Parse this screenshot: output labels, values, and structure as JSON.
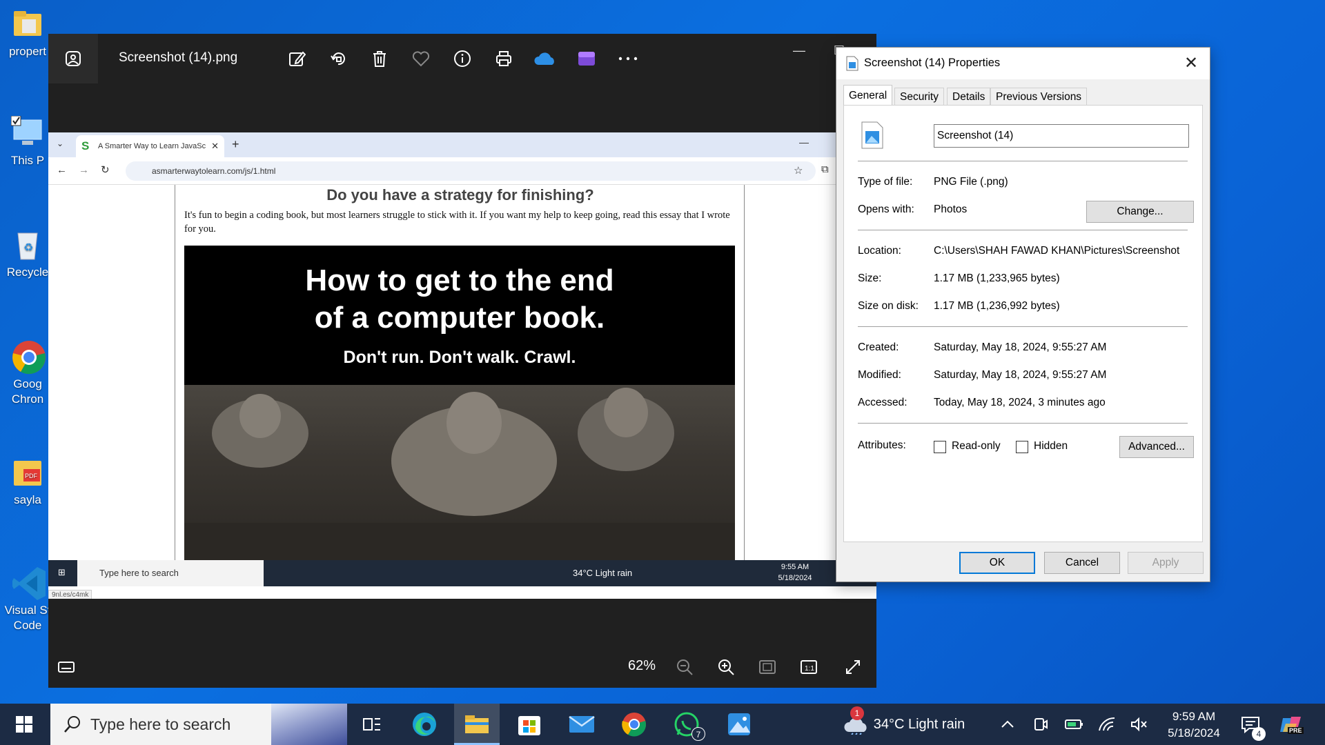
{
  "desktop": {
    "icons": [
      {
        "label": "propert",
        "icon": "folder-icon"
      },
      {
        "label": "This P",
        "icon": "this-pc-icon"
      },
      {
        "label": "Recycle",
        "icon": "recycle-bin-icon"
      },
      {
        "label": "Goog",
        "label2": "Chron",
        "icon": "chrome-icon"
      },
      {
        "label": "sayla",
        "icon": "pdf-folder-icon"
      },
      {
        "label": "Visual St",
        "label2": "Code",
        "icon": "vscode-icon"
      }
    ]
  },
  "photos": {
    "file_title": "Screenshot (14).png",
    "toolbar": [
      "edit-image-icon",
      "rotate-icon",
      "delete-icon",
      "favorite-icon",
      "info-icon",
      "print-icon",
      "onedrive-icon",
      "clipchamp-icon",
      "more-icon"
    ],
    "zoom": "62%",
    "window_controls": {
      "minimize": "—",
      "maximize": "☐"
    }
  },
  "screenshot": {
    "tab_title": "A Smarter Way to Learn JavaSc",
    "url": "asmarterwaytolearn.com/js/1.html",
    "heading": "Do you have a strategy for finishing?",
    "paragraph": "It's fun to begin a coding book, but most learners struggle to stick with it. If you want my help to keep going, read this essay that I wrote for you.",
    "banner_line1": "How to get to the end",
    "banner_line2": "of a computer book.",
    "banner_sub": "Don't run. Don't walk. Crawl.",
    "status_link": "9nl.es/c4mk",
    "taskbar_search": "Type here to search",
    "weather": "34°C  Light rain",
    "time": "9:55 AM",
    "date": "5/18/2024"
  },
  "properties": {
    "title": "Screenshot (14) Properties",
    "tabs": [
      "General",
      "Security",
      "Details",
      "Previous Versions"
    ],
    "name": "Screenshot (14)",
    "type_label": "Type of file:",
    "type_value": "PNG File (.png)",
    "opens_label": "Opens with:",
    "opens_value": "Photos",
    "change_btn": "Change...",
    "location_label": "Location:",
    "location_value": "C:\\Users\\SHAH FAWAD KHAN\\Pictures\\Screenshot",
    "size_label": "Size:",
    "size_value": "1.17 MB (1,233,965 bytes)",
    "disk_label": "Size on disk:",
    "disk_value": "1.17 MB (1,236,992 bytes)",
    "created_label": "Created:",
    "created_value": "Saturday, May 18, 2024, 9:55:27 AM",
    "modified_label": "Modified:",
    "modified_value": "Saturday, May 18, 2024, 9:55:27 AM",
    "accessed_label": "Accessed:",
    "accessed_value": "Today, May 18, 2024, 3 minutes ago",
    "attributes_label": "Attributes:",
    "readonly_label": "Read-only",
    "hidden_label": "Hidden",
    "advanced_btn": "Advanced...",
    "ok_btn": "OK",
    "cancel_btn": "Cancel",
    "apply_btn": "Apply",
    "readonly_checked": false,
    "hidden_checked": false
  },
  "taskbar": {
    "search_placeholder": "Type here to search",
    "apps": [
      "task-view-icon",
      "edge-icon",
      "file-explorer-icon",
      "store-icon",
      "mail-icon",
      "chrome-icon",
      "whatsapp-icon",
      "photos-icon"
    ],
    "whatsapp_badge": "7",
    "weather_badge": "1",
    "weather": "34°C  Light rain",
    "time": "9:59 AM",
    "date": "5/18/2024",
    "notifications": "4",
    "copilot_label": "PRE"
  },
  "colors": {
    "desktop": "#0a63d6",
    "taskbar": "#1c2b44",
    "photos_bg": "#202020",
    "accent": "#0078d7"
  }
}
